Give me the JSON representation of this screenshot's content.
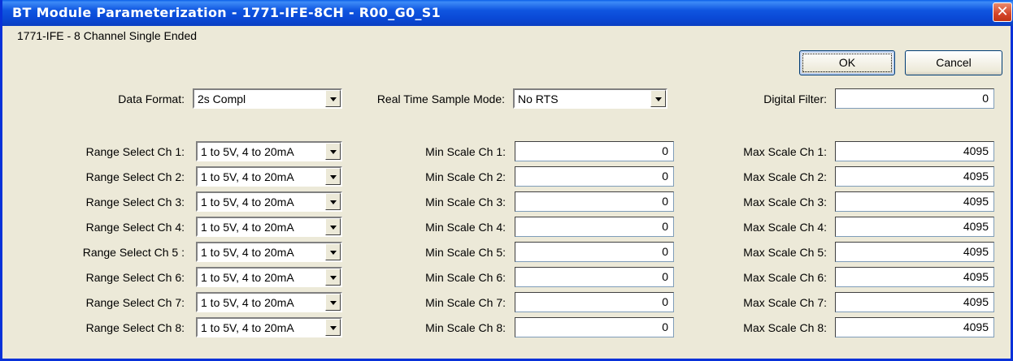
{
  "window": {
    "title": "BT Module Parameterization - 1771-IFE-8CH - R00_G0_S1",
    "close_symbol": "✕"
  },
  "module_description": "1771-IFE - 8 Channel Single Ended",
  "buttons": {
    "ok": "OK",
    "cancel": "Cancel"
  },
  "data_format": {
    "label": "Data Format:",
    "value": "2s Compl"
  },
  "rts": {
    "label": "Real Time Sample Mode:",
    "value": "No RTS"
  },
  "digital_filter": {
    "label": "Digital Filter:",
    "value": "0"
  },
  "channels": [
    {
      "range_label": "Range Select Ch 1:",
      "range_value": "1 to  5V,  4 to 20mA",
      "min_label": "Min Scale Ch 1:",
      "min_value": "0",
      "max_label": "Max Scale Ch 1:",
      "max_value": "4095"
    },
    {
      "range_label": "Range Select Ch 2:",
      "range_value": "1 to  5V,  4 to 20mA",
      "min_label": "Min Scale Ch 2:",
      "min_value": "0",
      "max_label": "Max Scale Ch 2:",
      "max_value": "4095"
    },
    {
      "range_label": "Range Select Ch 3:",
      "range_value": "1 to  5V,  4 to 20mA",
      "min_label": "Min Scale Ch 3:",
      "min_value": "0",
      "max_label": "Max Scale Ch 3:",
      "max_value": "4095"
    },
    {
      "range_label": "Range Select Ch 4:",
      "range_value": "1 to  5V,  4 to 20mA",
      "min_label": "Min Scale Ch 4:",
      "min_value": "0",
      "max_label": "Max Scale Ch 4:",
      "max_value": "4095"
    },
    {
      "range_label": "Range Select Ch 5 :",
      "range_value": "1 to  5V,  4 to 20mA",
      "min_label": "Min Scale Ch 5:",
      "min_value": "0",
      "max_label": "Max Scale Ch 5:",
      "max_value": "4095"
    },
    {
      "range_label": "Range Select Ch 6:",
      "range_value": "1 to  5V,  4 to 20mA",
      "min_label": "Min Scale Ch 6:",
      "min_value": "0",
      "max_label": "Max Scale Ch 6:",
      "max_value": "4095"
    },
    {
      "range_label": "Range Select Ch 7:",
      "range_value": "1 to  5V,  4 to 20mA",
      "min_label": "Min Scale Ch 7:",
      "min_value": "0",
      "max_label": "Max Scale Ch 7:",
      "max_value": "4095"
    },
    {
      "range_label": "Range Select Ch 8:",
      "range_value": "1 to  5V,  4 to 20mA",
      "min_label": "Min Scale Ch 8:",
      "min_value": "0",
      "max_label": "Max Scale Ch 8:",
      "max_value": "4095"
    }
  ]
}
